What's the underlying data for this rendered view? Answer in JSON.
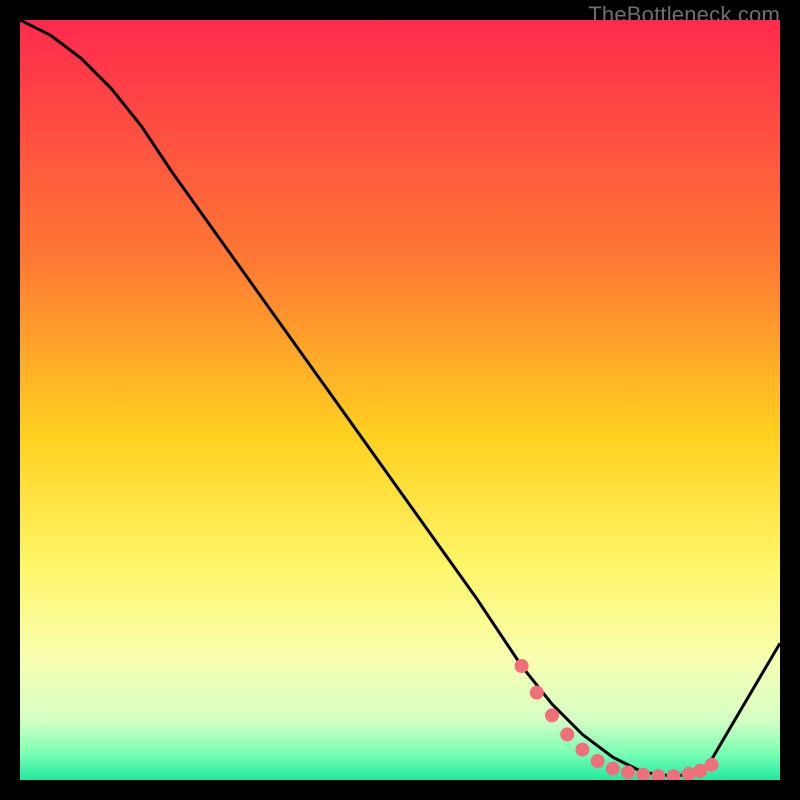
{
  "watermark": "TheBottleneck.com",
  "chart_data": {
    "type": "line",
    "title": "",
    "xlabel": "",
    "ylabel": "",
    "xlim": [
      0,
      100
    ],
    "ylim": [
      0,
      100
    ],
    "grid": false,
    "legend": false,
    "gradient_stops": [
      {
        "offset": 0,
        "color": "#ff2a4d"
      },
      {
        "offset": 0.32,
        "color": "#ff7a33"
      },
      {
        "offset": 0.55,
        "color": "#ffd21f"
      },
      {
        "offset": 0.72,
        "color": "#fff66a"
      },
      {
        "offset": 0.84,
        "color": "#f7ffb0"
      },
      {
        "offset": 0.92,
        "color": "#d6ffc4"
      },
      {
        "offset": 0.965,
        "color": "#7affb5"
      },
      {
        "offset": 1.0,
        "color": "#20e8a0"
      }
    ],
    "series": [
      {
        "name": "bottleneck-curve",
        "color": "#000000",
        "x": [
          0,
          4,
          8,
          12,
          16,
          20,
          30,
          40,
          50,
          60,
          66,
          70,
          74,
          78,
          82,
          86,
          90,
          100
        ],
        "y": [
          100,
          98,
          95,
          91,
          86,
          80,
          66,
          52,
          38,
          24,
          15,
          10,
          6,
          3,
          1,
          0.5,
          1,
          18
        ]
      }
    ],
    "markers": {
      "name": "highlight-dots",
      "color": "#ef6f7a",
      "radius": 7,
      "x": [
        66,
        68,
        70,
        72,
        74,
        76,
        78,
        80,
        82,
        84,
        86,
        88,
        89.5,
        91
      ],
      "y": [
        15,
        11.5,
        8.5,
        6,
        4,
        2.5,
        1.5,
        1,
        0.7,
        0.5,
        0.5,
        0.8,
        1.2,
        2
      ]
    }
  }
}
